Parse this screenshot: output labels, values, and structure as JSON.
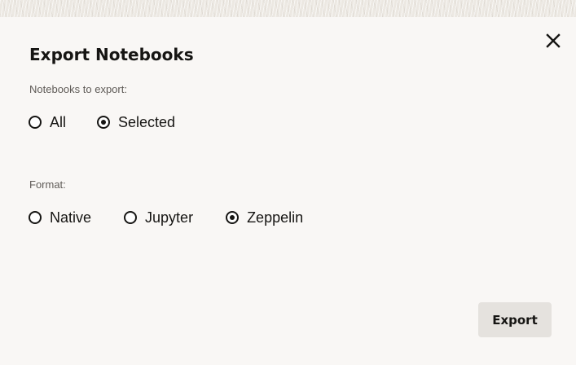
{
  "dialog": {
    "title": "Export Notebooks",
    "close_icon": "close-icon",
    "notebooks": {
      "label": "Notebooks to export:",
      "options": [
        {
          "label": "All",
          "selected": false
        },
        {
          "label": "Selected",
          "selected": true
        }
      ]
    },
    "format": {
      "label": "Format:",
      "options": [
        {
          "label": "Native",
          "selected": false
        },
        {
          "label": "Jupyter",
          "selected": false
        },
        {
          "label": "Zeppelin",
          "selected": true
        }
      ]
    },
    "export_label": "Export"
  },
  "colors": {
    "background": "#f9f7f5",
    "text": "#161513",
    "muted_text": "#5f5b57",
    "button_bg": "#e5e2de"
  }
}
